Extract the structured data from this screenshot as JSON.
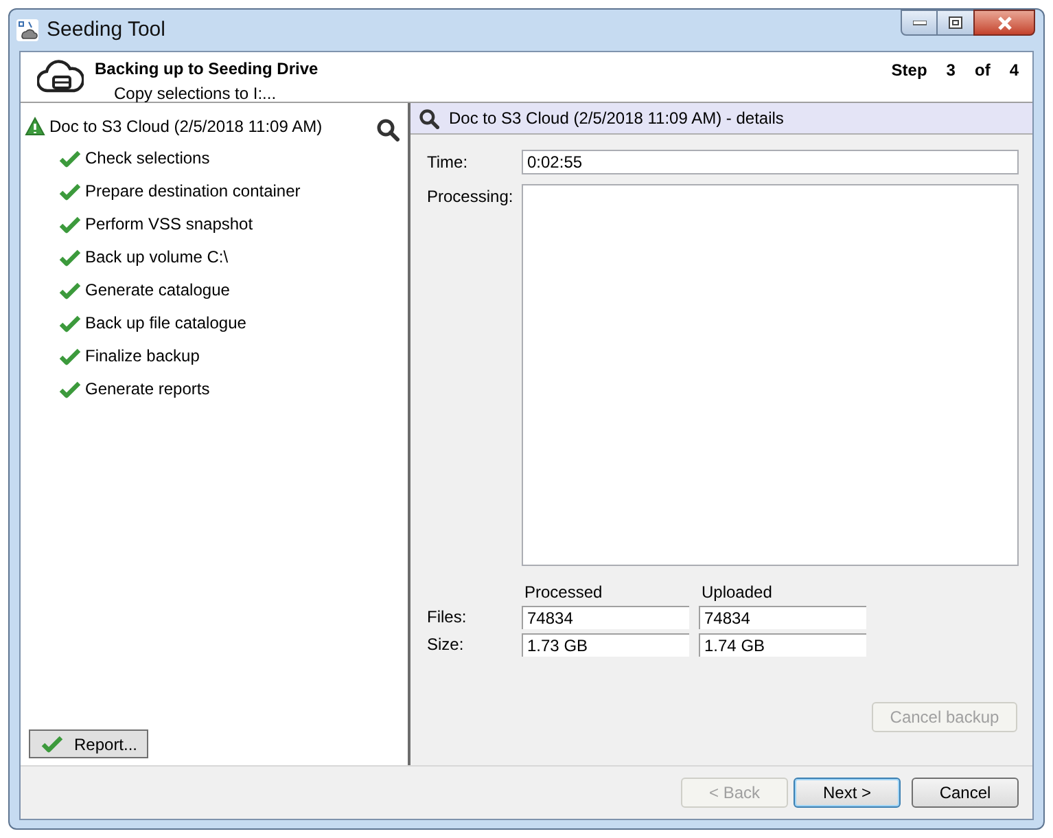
{
  "window": {
    "title": "Seeding Tool"
  },
  "header": {
    "title": "Backing up to Seeding Drive",
    "subtitle": "Copy selections to I:...",
    "step_label": "Step",
    "step": "3",
    "of_label": "of",
    "total": "4"
  },
  "tree": {
    "label": "Doc to S3 Cloud (2/5/2018 11:09 AM)",
    "warning": true,
    "children": [
      {
        "label": "Check selections",
        "done": true
      },
      {
        "label": "Prepare destination container",
        "done": true
      },
      {
        "label": "Perform VSS snapshot",
        "done": true
      },
      {
        "label": "Back up volume C:\\",
        "done": true
      },
      {
        "label": "Generate catalogue",
        "done": true
      },
      {
        "label": "Back up file catalogue",
        "done": true
      },
      {
        "label": "Finalize backup",
        "done": true
      },
      {
        "label": "Generate reports",
        "done": true
      }
    ]
  },
  "report_button": {
    "label": "Report...",
    "disabled": false
  },
  "details": {
    "title": "Doc to S3 Cloud (2/5/2018 11:09 AM) - details",
    "time_label": "Time:",
    "time": "0:02:55",
    "processing_label": "Processing:",
    "columns": [
      "Processed",
      "Uploaded"
    ],
    "rows": [
      {
        "label": "Files:",
        "values": [
          "74834",
          "74834"
        ]
      },
      {
        "label": "Size:",
        "values": [
          "1.73 GB",
          "1.74 GB"
        ]
      }
    ],
    "cancel_button": {
      "label": "Cancel backup",
      "disabled": true
    }
  },
  "buttons": [
    {
      "label": "< Back",
      "disabled": true,
      "default": false
    },
    {
      "label": "Next >",
      "disabled": false,
      "default": true
    },
    {
      "label": "Cancel",
      "disabled": false,
      "default": false
    }
  ]
}
